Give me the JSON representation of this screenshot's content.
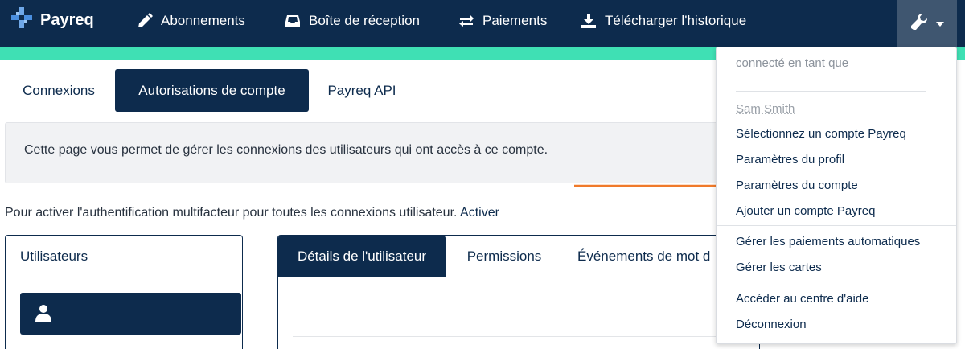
{
  "brand": {
    "name": "Payreq"
  },
  "nav": {
    "items": [
      {
        "label": "Abonnements",
        "icon": "pencil-icon"
      },
      {
        "label": "Boîte de réception",
        "icon": "inbox-icon"
      },
      {
        "label": "Paiements",
        "icon": "exchange-icon"
      },
      {
        "label": "Télécharger l'historique",
        "icon": "download-icon"
      }
    ],
    "settings_icon": "wrench-icon"
  },
  "tabs": [
    {
      "label": "Connexions",
      "active": false
    },
    {
      "label": "Autorisations de compte",
      "active": true
    },
    {
      "label": "Payreq API",
      "active": false
    }
  ],
  "info": {
    "text": "Cette page vous permet de gérer les connexions des utilisateurs qui ont accès à ce compte."
  },
  "mfa": {
    "text": "Pour activer l'authentification multifacteur pour toutes les connexions utilisateur.",
    "link": "Activer"
  },
  "users_panel": {
    "title": "Utilisateurs"
  },
  "details_tabs": [
    {
      "label": "Détails de l'utilisateur",
      "active": true
    },
    {
      "label": "Permissions",
      "active": false
    },
    {
      "label": "Événements de mot d",
      "active": false
    }
  ],
  "dropdown": {
    "header": "connecté en tant que",
    "user": "Sam Smith",
    "items_group1": [
      "Sélectionnez un compte Payreq",
      "Paramètres du profil",
      "Paramètres du compte",
      "Ajouter un compte Payreq"
    ],
    "items_group2": [
      "Gérer les paiements automatiques",
      "Gérer les cartes"
    ],
    "items_group3": [
      "Accéder au centre d'aide",
      "Déconnexion"
    ]
  },
  "colors": {
    "navy": "#0d2b4d",
    "accent": "#3fe0b4",
    "arrow": "#f07a2a"
  }
}
